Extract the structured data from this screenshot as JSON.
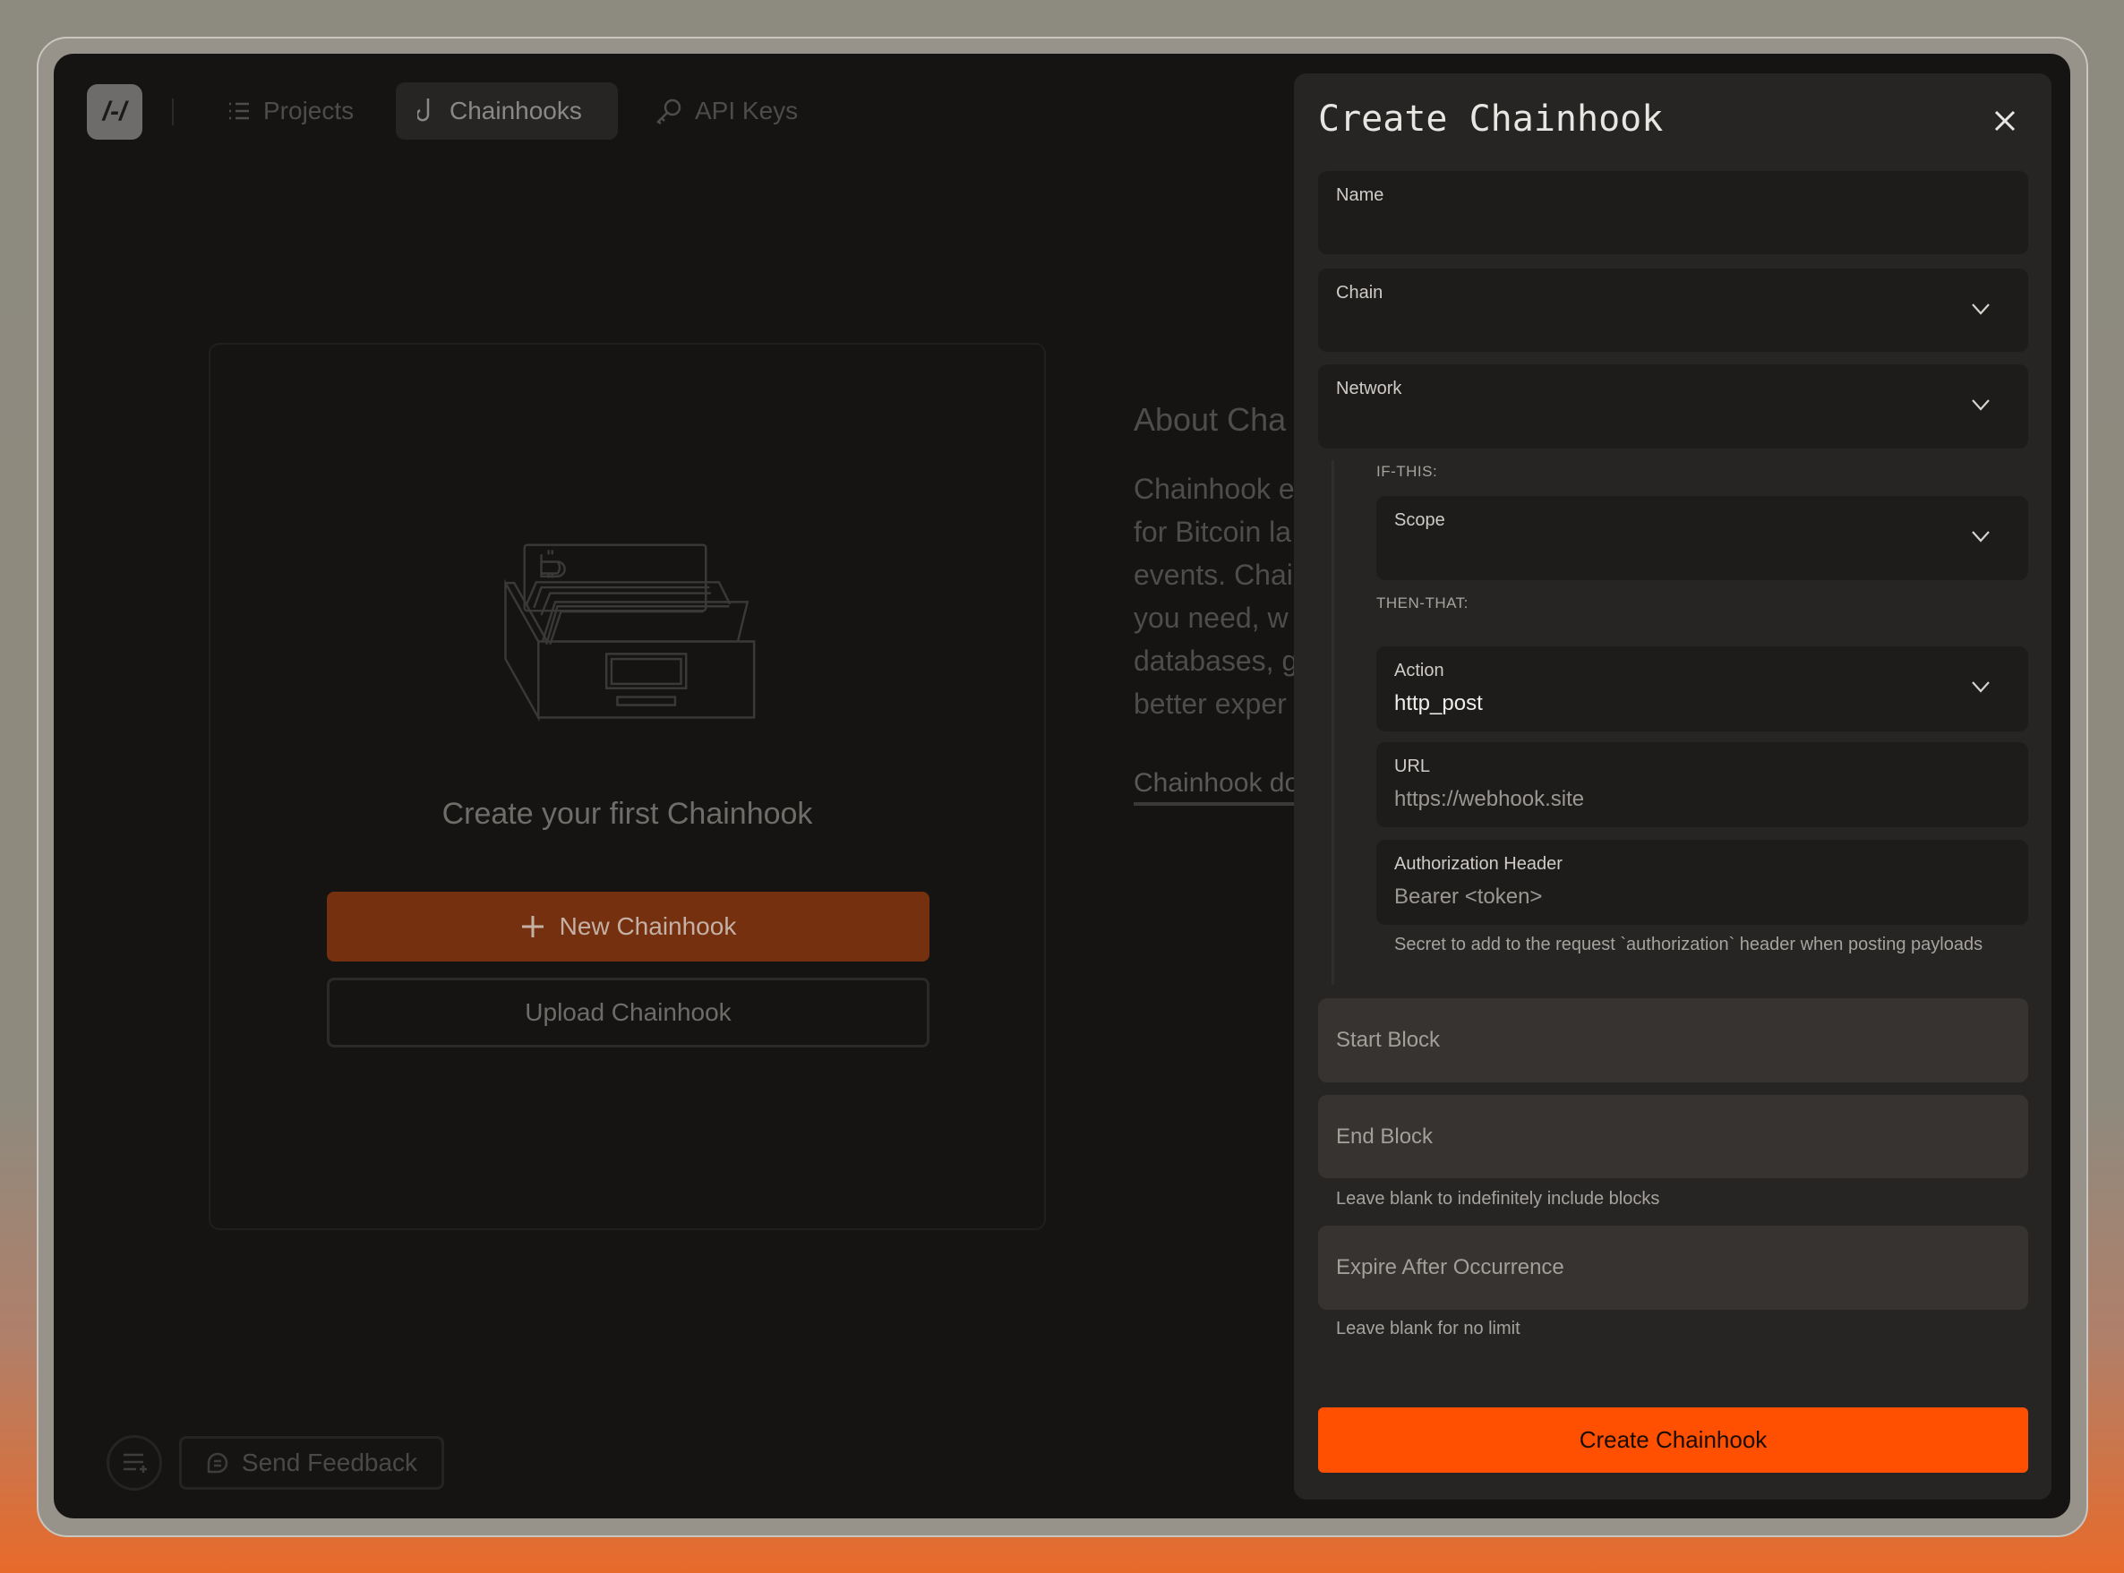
{
  "nav": {
    "logo": "/-/",
    "items": [
      {
        "label": "Projects",
        "icon": "list-icon"
      },
      {
        "label": "Chainhooks",
        "icon": "hook-icon",
        "active": true
      },
      {
        "label": "API Keys",
        "icon": "key-icon"
      }
    ]
  },
  "empty_state": {
    "title": "Create your first Chainhook",
    "new_button": "New Chainhook",
    "upload_button": "Upload Chainhook"
  },
  "about": {
    "title": "About Cha",
    "lines": [
      "Chainhook e",
      "for Bitcoin la",
      "events. Chai",
      "you need, w",
      "databases, g",
      "better exper"
    ],
    "link": "Chainhook do"
  },
  "footer": {
    "feedback_label": "Send Feedback"
  },
  "panel": {
    "title": "Create Chainhook",
    "name_label": "Name",
    "chain_label": "Chain",
    "network_label": "Network",
    "if_this": "IF-THIS:",
    "scope_label": "Scope",
    "then_that": "THEN-THAT:",
    "action_label": "Action",
    "action_value": "http_post",
    "url_label": "URL",
    "url_placeholder": "https://webhook.site",
    "auth_label": "Authorization Header",
    "auth_placeholder": "Bearer <token>",
    "auth_help": "Secret to add to the request `authorization` header when posting payloads",
    "start_block": "Start Block",
    "end_block": "End Block",
    "end_help": "Leave blank to indefinitely include blocks",
    "expire": "Expire After Occurrence",
    "expire_help": "Leave blank for no limit",
    "submit": "Create Chainhook"
  },
  "colors": {
    "accent": "#fe5000",
    "accent_dim": "#74300f",
    "panel_bg": "#262524",
    "app_bg": "#151413"
  }
}
